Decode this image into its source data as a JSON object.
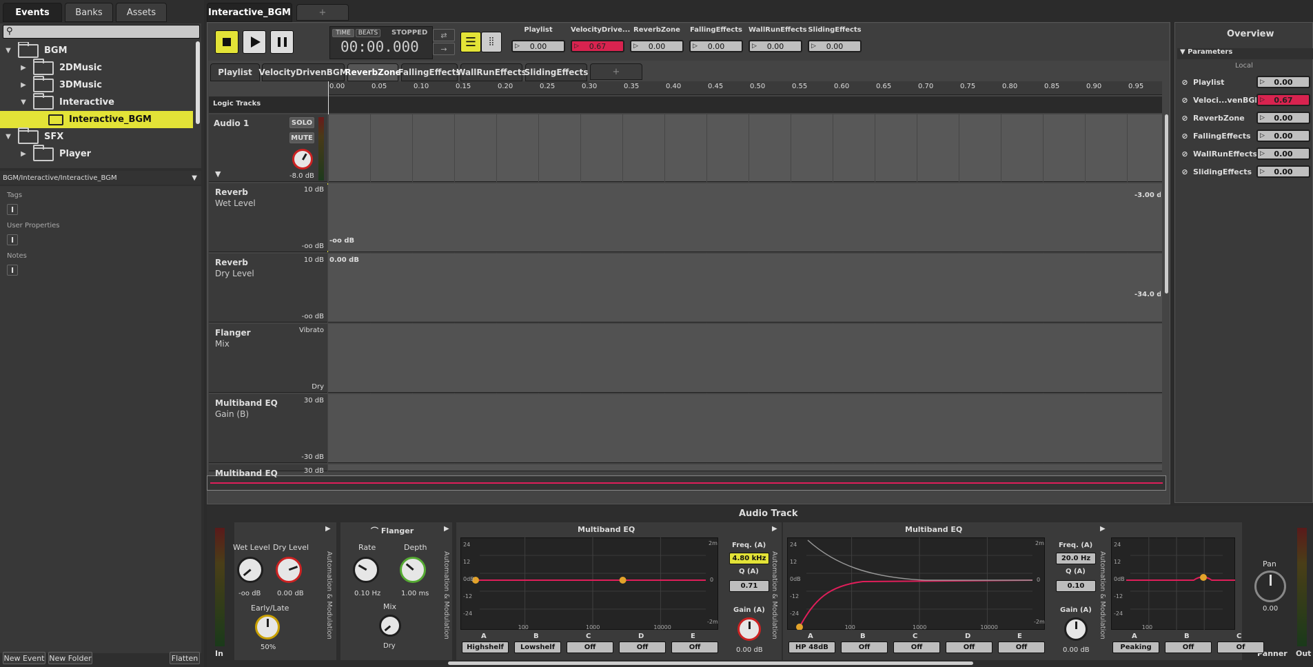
{
  "left_tabs": [
    "Events",
    "Banks",
    "Assets"
  ],
  "tree": [
    {
      "label": "BGM",
      "indent": 0,
      "tri": "▼"
    },
    {
      "label": "2DMusic",
      "indent": 1,
      "tri": "▶"
    },
    {
      "label": "3DMusic",
      "indent": 1,
      "tri": "▶"
    },
    {
      "label": "Interactive",
      "indent": 1,
      "tri": "▼"
    },
    {
      "label": "Interactive_BGM",
      "indent": 2,
      "tri": "",
      "selected": true
    },
    {
      "label": "SFX",
      "indent": 0,
      "tri": "▼"
    },
    {
      "label": "Player",
      "indent": 1,
      "tri": "▶"
    }
  ],
  "event_path": "BGM/Interactive/Interactive_BGM",
  "inspector": {
    "tags": "Tags",
    "user_props": "User Properties",
    "notes": "Notes"
  },
  "bottom_buttons": {
    "new_event": "New Event",
    "new_folder": "New Folder",
    "flatten": "Flatten"
  },
  "editor_tab": "Interactive_BGM",
  "transport": {
    "time": "TIME",
    "beats": "BEATS",
    "state": "STOPPED",
    "clock": "00:00.000"
  },
  "top_params": [
    {
      "name": "Playlist",
      "value": "0.00"
    },
    {
      "name": "VelocityDrive...",
      "value": "0.67",
      "red": true
    },
    {
      "name": "ReverbZone",
      "value": "0.00"
    },
    {
      "name": "FallingEffects",
      "value": "0.00"
    },
    {
      "name": "WallRunEffects",
      "value": "0.00"
    },
    {
      "name": "SlidingEffects",
      "value": "0.00"
    }
  ],
  "param_tabs": [
    "Playlist",
    "VelocityDrivenBGM",
    "ReverbZone",
    "FallingEffects",
    "WallRunEffects",
    "SlidingEffects"
  ],
  "ruler": [
    "0.00",
    "0.05",
    "0.10",
    "0.15",
    "0.20",
    "0.25",
    "0.30",
    "0.35",
    "0.40",
    "0.45",
    "0.50",
    "0.55",
    "0.60",
    "0.65",
    "0.70",
    "0.75",
    "0.80",
    "0.85",
    "0.90",
    "0.95"
  ],
  "logic_tracks": "Logic Tracks",
  "audio_track": {
    "name": "Audio 1",
    "solo": "SOLO",
    "mute": "MUTE",
    "db": "-8.0 dB"
  },
  "automation": [
    {
      "title": "Reverb",
      "sub": "Wet Level",
      "top": "10 dB",
      "bottom": "-oo dB",
      "start": "-oo dB",
      "end": "-3.00 d"
    },
    {
      "title": "Reverb",
      "sub": "Dry Level",
      "top": "10 dB",
      "bottom": "-oo dB",
      "start": "0.00 dB",
      "end": "-34.0 d"
    },
    {
      "title": "Flanger",
      "sub": "Mix",
      "top": "Vibrato",
      "bottom": "Dry"
    },
    {
      "title": "Multiband EQ",
      "sub": "Gain (B)",
      "top": "30 dB",
      "bottom": "-30 dB"
    },
    {
      "title": "Multiband EQ",
      "sub": "",
      "top": "30 dB"
    }
  ],
  "overview": {
    "title": "Overview",
    "params": "Parameters",
    "local": "Local",
    "rows": [
      {
        "name": "Playlist",
        "value": "0.00"
      },
      {
        "name": "Veloci...venBGM",
        "value": "0.67",
        "red": true
      },
      {
        "name": "ReverbZone",
        "value": "0.00"
      },
      {
        "name": "FallingEffects",
        "value": "0.00"
      },
      {
        "name": "WallRunEffects",
        "value": "0.00"
      },
      {
        "name": "SlidingEffects",
        "value": "0.00"
      }
    ]
  },
  "deck": {
    "title": "Audio Track",
    "in": "In",
    "out": "Out",
    "reverb": {
      "wet": "Wet Level",
      "dry": "Dry Level",
      "wet_v": "-oo dB",
      "dry_v": "0.00 dB",
      "early": "Early/Late",
      "early_v": "50%"
    },
    "flanger": {
      "title": "Flanger",
      "rate": "Rate",
      "depth": "Depth",
      "rate_v": "0.10 Hz",
      "depth_v": "1.00 ms",
      "mix": "Mix",
      "mix_v": "Dry"
    },
    "eq1": {
      "title": "Multiband EQ",
      "freq": "Freq. (A)",
      "freq_v": "4.80 kHz",
      "q": "Q (A)",
      "q_v": "0.71",
      "gain": "Gain (A)",
      "gain_v": "0.00 dB",
      "bands": [
        "A",
        "B",
        "C",
        "D",
        "E"
      ],
      "types": [
        "Highshelf",
        "Lowshelf",
        "Off",
        "Off",
        "Off"
      ]
    },
    "eq2": {
      "title": "Multiband EQ",
      "freq": "Freq. (A)",
      "freq_v": "20.0 Hz",
      "q": "Q (A)",
      "q_v": "0.10",
      "gain": "Gain (A)",
      "gain_v": "0.00 dB",
      "bands": [
        "A",
        "B",
        "C",
        "D",
        "E"
      ],
      "types": [
        "HP 48dB",
        "Off",
        "Off",
        "Off",
        "Off"
      ]
    },
    "eq3": {
      "bands": [
        "A",
        "B",
        "C"
      ],
      "types": [
        "Peaking",
        "Off",
        "Of"
      ]
    },
    "eq_axis": {
      "y": [
        "24",
        "12",
        "0dB",
        "-12",
        "-24"
      ],
      "x": [
        "100",
        "1000",
        "10000"
      ],
      "r_top": "2m",
      "r_mid": "0",
      "r_bot": "-2m"
    },
    "auto_mod": "Automation & Modulation",
    "pan": "Pan",
    "pan_v": "0.00",
    "panner": "Panner"
  },
  "colors": {
    "accent": "#e3e337",
    "curve": "#e01e5a"
  }
}
